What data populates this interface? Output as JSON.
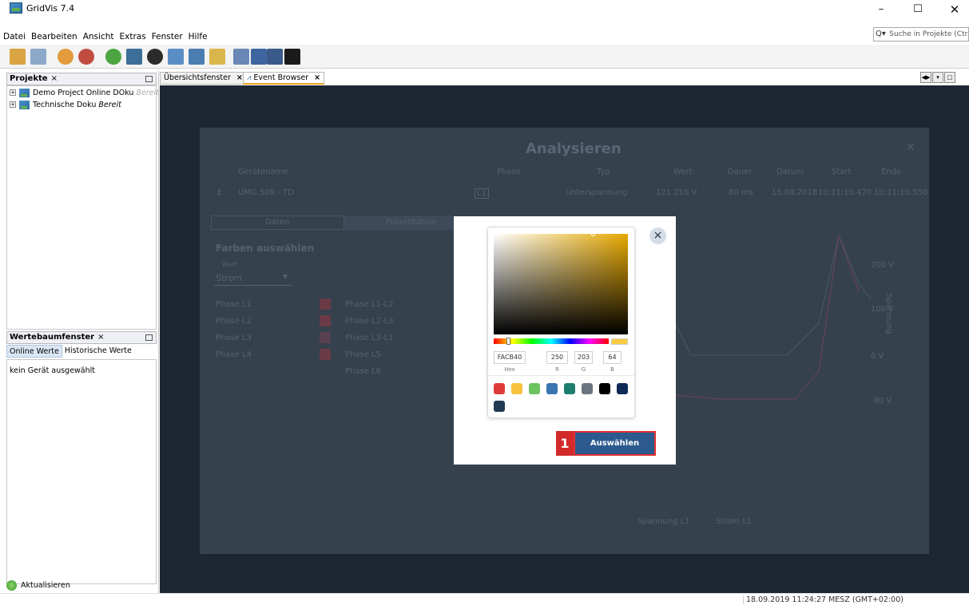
{
  "window": {
    "title": "GridVis 7.4",
    "min": "–",
    "max": "☐",
    "close": "✕"
  },
  "menu": [
    "Datei",
    "Bearbeiten",
    "Ansicht",
    "Extras",
    "Fenster",
    "Hilfe"
  ],
  "search": {
    "placeholder": "Suche in Projekte (Ctrl+I)"
  },
  "projects_pane": {
    "title": "Projekte",
    "items": [
      {
        "name": "Demo Project Online DOku",
        "state": "Bereit"
      },
      {
        "name": "Technische Doku",
        "state": "Bereit"
      }
    ]
  },
  "values_pane": {
    "title": "Wertebaumfenster",
    "tabs": [
      "Online Werte",
      "Historische Werte"
    ],
    "empty_text": "kein Gerät ausgewählt",
    "refresh_label": "Aktualisieren"
  },
  "editor_tabs": [
    "Übersichtsfenster",
    "Event Browser"
  ],
  "background_dialog": {
    "title": "Analysieren",
    "columns": [
      "Gerätename",
      "Phase",
      "Typ",
      "Wert",
      "Dauer",
      "Datum",
      "Start",
      "Ende"
    ],
    "row": {
      "device": "UMG 509 - TD",
      "phase": "L1",
      "type": "Unterspannung",
      "value": "121.216 V",
      "duration": "80 ms",
      "date": "15.08.2018",
      "start": "10:11:10.470",
      "end": "10:11:10.550"
    },
    "tabs": [
      "Daten",
      "Präsentation"
    ],
    "section_title": "Farben auswählen",
    "value_label": "Wert",
    "value_select": "Strom",
    "phases_left": [
      "Phase L1",
      "Phase L2",
      "Phase L3",
      "Phase L4"
    ],
    "phases_right": [
      "Phase L1-L2",
      "Phase L2-L3",
      "Phase L3-L1",
      "Phase L5",
      "Phase L6"
    ],
    "y_ticks": [
      "200 V",
      "100 V",
      "0 V",
      "-80 V"
    ],
    "y_axis_label": "Spannung",
    "legend": [
      "Spannung L1",
      "Strom L1"
    ]
  },
  "color_picker": {
    "hex": "FACB40",
    "r": "250",
    "g": "203",
    "b": "64",
    "labels": {
      "hex": "Hex",
      "r": "R",
      "g": "G",
      "b": "B"
    },
    "current_color": "#facb40",
    "swatches": [
      "#e03b3b",
      "#f6c23e",
      "#6cc35f",
      "#3b74b3",
      "#1e7e6e",
      "#6b7580",
      "#000000",
      "#0e2a55",
      "#233a55"
    ]
  },
  "modal": {
    "close": "×",
    "select_label": "Auswählen"
  },
  "step_badge": "1",
  "status": {
    "clock": "18.09.2019 11:24:27 MESZ (GMT+02:00)"
  },
  "colors": {
    "workspace": "#1d2733",
    "dim_panel": "#36414e",
    "primary_button": "#2d5a8e",
    "highlight": "#e03030"
  }
}
